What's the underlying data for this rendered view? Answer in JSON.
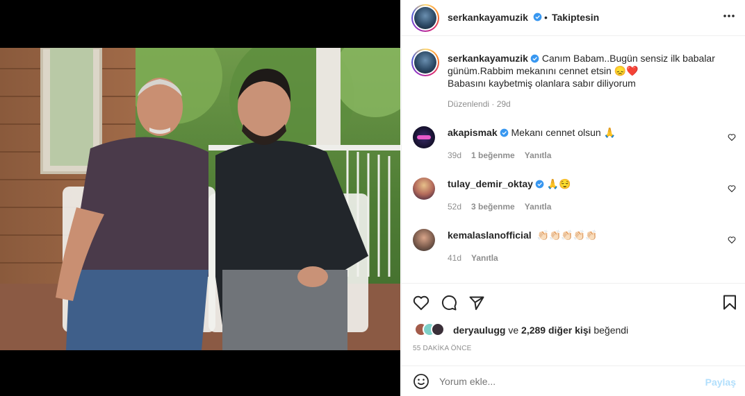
{
  "post": {
    "author": "serkankayamuzik",
    "follow_status": "Takiptesin",
    "caption_line1": "Canım Babam..Bugün sensiz ilk babalar",
    "caption_line2": "günüm.Rabbim mekanını cennet etsin 😞❤️",
    "caption_line3": "Babasını kaybetmiş olanlara sabır diliyorum",
    "edited_meta": "Düzenlendi · 29d"
  },
  "comments": [
    {
      "user": "akapismak",
      "verified": true,
      "text": "Mekanı cennet olsun 🙏",
      "age": "39d",
      "likes": "1 beğenme",
      "reply": "Yanıtla"
    },
    {
      "user": "tulay_demir_oktay",
      "verified": true,
      "text": "🙏😌",
      "age": "52d",
      "likes": "3 beğenme",
      "reply": "Yanıtla"
    },
    {
      "user": "kemalaslanofficial",
      "verified": false,
      "text": "👏🏻👏🏻👏🏻👏🏻👏🏻",
      "age": "41d",
      "likes": "",
      "reply": "Yanıtla"
    }
  ],
  "likes_summary": {
    "user": "deryaulugg",
    "connector": "ve",
    "count": "2,289 diğer kişi",
    "suffix": "beğendi"
  },
  "timestamp": "55 DAKİKA ÖNCE",
  "add_comment": {
    "placeholder": "Yorum ekle...",
    "post_label": "Paylaş"
  },
  "colors": {
    "verified": "#3897f0",
    "link_blue": "#b2dffc",
    "text": "#262626",
    "meta": "#8e8e8e"
  }
}
